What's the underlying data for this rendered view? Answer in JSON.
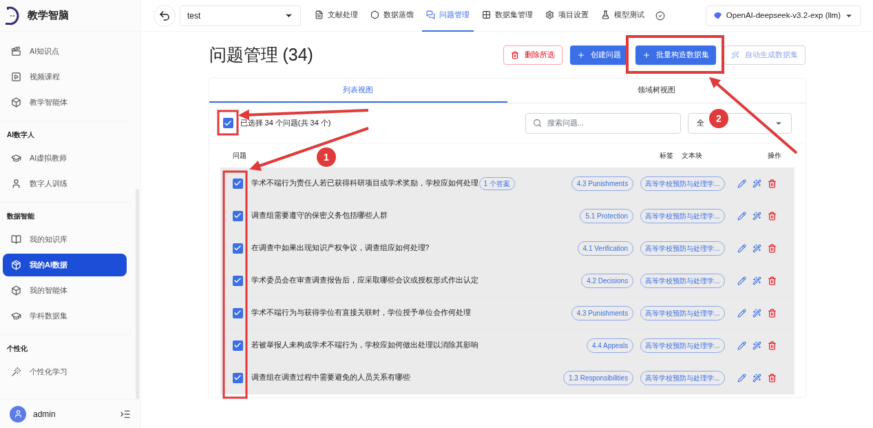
{
  "app": {
    "name": "教学智脑"
  },
  "sidebar": {
    "sections": [
      {
        "items": [
          {
            "label": "AI知识点",
            "selected": false
          },
          {
            "label": "视频课程",
            "selected": false
          },
          {
            "label": "教学智能体",
            "selected": false
          }
        ]
      },
      {
        "title": "AI数字人",
        "items": [
          {
            "label": "AI虚拟教师",
            "selected": false
          },
          {
            "label": "数字人训练",
            "selected": false
          }
        ]
      },
      {
        "title": "数据智能",
        "items": [
          {
            "label": "我的知识库",
            "selected": false
          },
          {
            "label": "我的AI数据",
            "selected": true
          },
          {
            "label": "我的智能体",
            "selected": false
          },
          {
            "label": "学科数据集",
            "selected": false
          }
        ]
      },
      {
        "title": "个性化",
        "items": [
          {
            "label": "个性化学习",
            "selected": false
          }
        ]
      }
    ],
    "user": {
      "name": "admin"
    }
  },
  "topbar": {
    "project": "test",
    "tabs": [
      {
        "label": "文献处理",
        "selected": false
      },
      {
        "label": "数据蒸馏",
        "selected": false
      },
      {
        "label": "问题管理",
        "selected": true
      },
      {
        "label": "数据集管理",
        "selected": false
      },
      {
        "label": "项目设置",
        "selected": false
      },
      {
        "label": "模型测试",
        "selected": false
      }
    ],
    "model": "OpenAI-deepseek-v3.2-exp (llm)"
  },
  "page": {
    "title": "问题管理 (34)",
    "buttons": [
      {
        "label": "删除所选",
        "kind": "danger"
      },
      {
        "label": "创建问题",
        "kind": "primary"
      },
      {
        "label": "批量构造数据集",
        "kind": "primary"
      },
      {
        "label": "自动生成数据集",
        "kind": "muted"
      }
    ],
    "view_tabs": [
      {
        "label": "列表视图",
        "selected": true
      },
      {
        "label": "领域树视图",
        "selected": false
      }
    ],
    "select_all": {
      "checked": true,
      "text": "已选择 34 个问题(共 34 个)"
    },
    "search": {
      "placeholder": "搜索问题..."
    },
    "filter": {
      "value": "全"
    },
    "columns": [
      "问题",
      "标签",
      "文本块",
      "操作"
    ],
    "rows": [
      {
        "question": "学术不端行为责任人若已获得科研项目或学术奖励，学校应如何处理",
        "answers": "1 个答案",
        "tag": "4.3 Punishments",
        "chunk": "高等学校预防与处理学...",
        "checked": true
      },
      {
        "question": "调查组需要遵守的保密义务包括哪些人群",
        "tag": "5.1 Protection",
        "chunk": "高等学校预防与处理学...",
        "checked": true
      },
      {
        "question": "在调查中如果出现知识产权争议，调查组应如何处理?",
        "tag": "4.1 Verification",
        "chunk": "高等学校预防与处理学...",
        "checked": true
      },
      {
        "question": "学术委员会在审查调查报告后，应采取哪些会议或授权形式作出认定",
        "tag": "4.2 Decisions",
        "chunk": "高等学校预防与处理学...",
        "checked": true
      },
      {
        "question": "学术不端行为与获得学位有直接关联时，学位授予单位会作何处理",
        "tag": "4.3 Punishments",
        "chunk": "高等学校预防与处理学...",
        "checked": true
      },
      {
        "question": "若被举报人未构成学术不端行为，学校应如何做出处理以消除其影响",
        "tag": "4.4 Appeals",
        "chunk": "高等学校预防与处理学...",
        "checked": true
      },
      {
        "question": "调查组在调查过程中需要避免的人员关系有哪些",
        "tag": "1.3 Responsibilities",
        "chunk": "高等学校预防与处理学...",
        "checked": true
      }
    ]
  },
  "annotations": {
    "badges": [
      "1",
      "2"
    ]
  }
}
